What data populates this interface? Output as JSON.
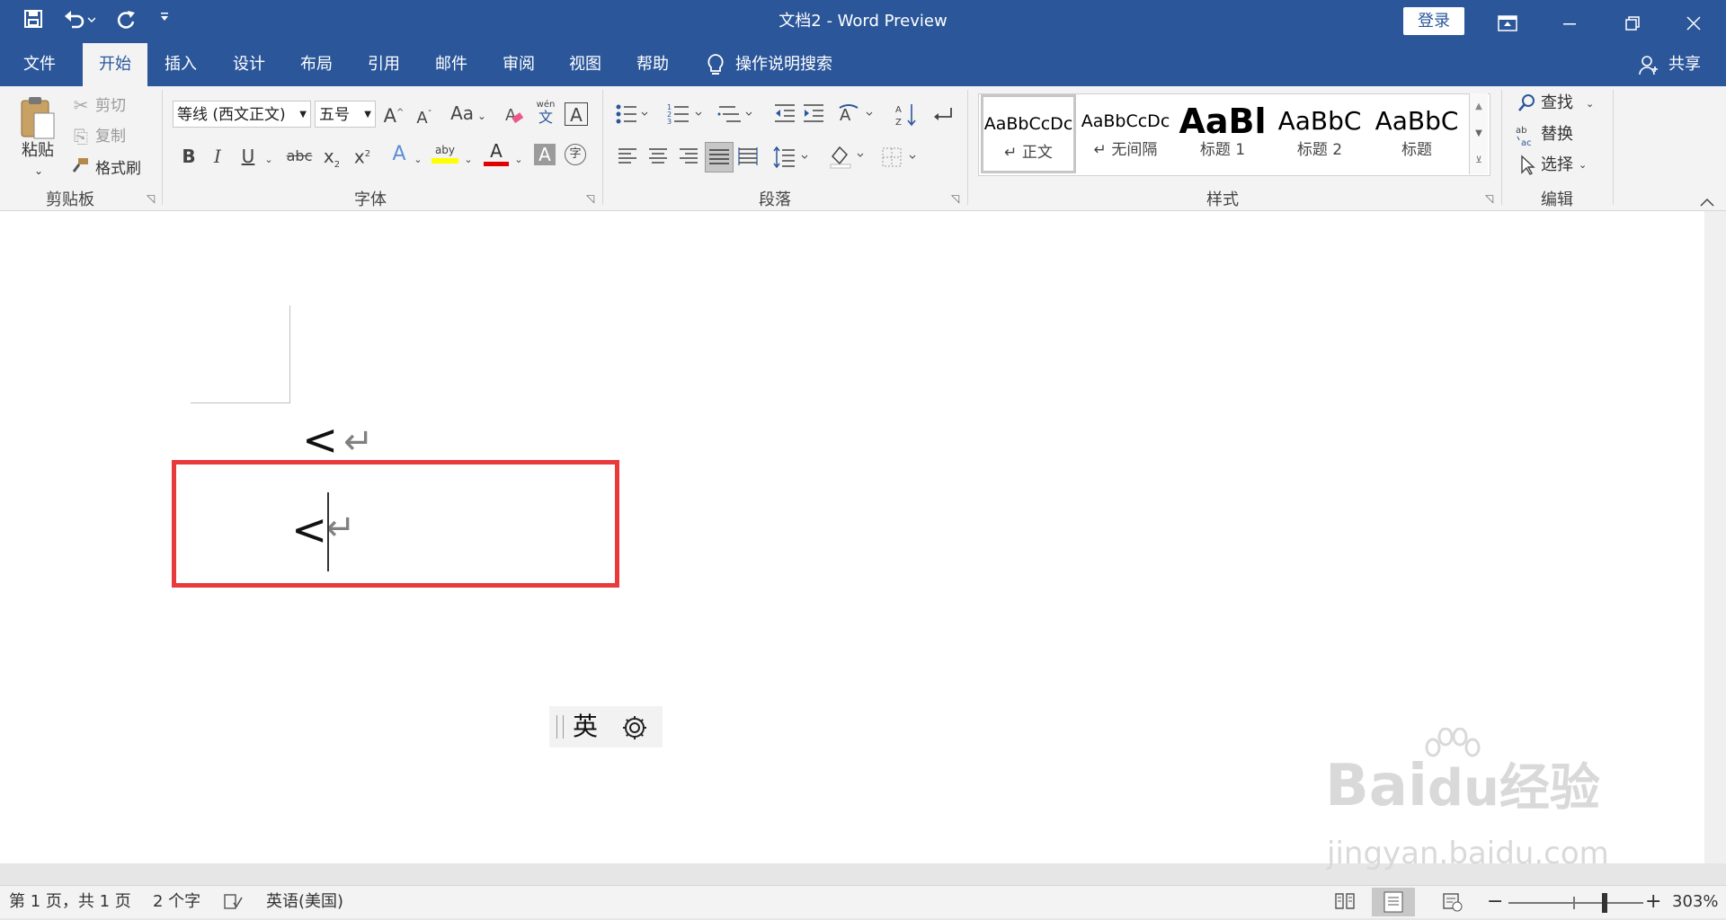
{
  "window": {
    "title": "文档2  -  Word Preview",
    "login_label": "登录",
    "accent_color": "#2b579a",
    "quick_access": [
      "save-icon",
      "undo-icon",
      "redo-icon",
      "customize-icon"
    ],
    "window_controls": [
      "ribbon-display-icon",
      "minimize-icon",
      "restore-icon",
      "close-icon"
    ]
  },
  "tabs": {
    "file": "文件",
    "home": "开始",
    "insert": "插入",
    "design": "设计",
    "layout": "布局",
    "references": "引用",
    "mailings": "邮件",
    "review": "审阅",
    "view": "视图",
    "help": "帮助",
    "tell_me": "操作说明搜索",
    "share": "共享",
    "active": "开始"
  },
  "ribbon": {
    "clipboard": {
      "label": "剪贴板",
      "paste": "粘贴",
      "cut": "剪切",
      "copy": "复制",
      "format_painter": "格式刷"
    },
    "font": {
      "label": "字体",
      "font_name": "等线 (西文正文)",
      "font_size": "五号",
      "grow": "A",
      "shrink": "A",
      "change_case": "Aa",
      "bold": "B",
      "italic": "I",
      "underline": "U",
      "strike": "abc",
      "subscript": "x",
      "superscript": "x",
      "sub_mark": "2",
      "sup_mark": "2",
      "phonetic": "wén",
      "phonetic_char": "文",
      "char_border": "A",
      "text_effects": "A",
      "highlight": "aby",
      "font_color": "A",
      "char_shading": "A",
      "enclose": "字",
      "highlight_color": "#ffff00",
      "font_color_value": "#e00000"
    },
    "paragraph": {
      "label": "段落"
    },
    "styles": {
      "label": "样式",
      "items": [
        {
          "sample": "AaBbCcDc",
          "name": "↵ 正文"
        },
        {
          "sample": "AaBbCcDc",
          "name": "↵ 无间隔"
        },
        {
          "sample": "AaBl",
          "name": "标题 1"
        },
        {
          "sample": "AaBbC",
          "name": "标题 2"
        },
        {
          "sample": "AaBbC",
          "name": "标题"
        }
      ]
    },
    "editing": {
      "label": "编辑",
      "find": "查找",
      "replace": "替换",
      "select": "选择"
    }
  },
  "document": {
    "line1": "<",
    "line2": "<",
    "para_mark": "↵",
    "highlight_color": "#e8393b"
  },
  "ime": {
    "mode": "英",
    "settings_icon": "gear-icon"
  },
  "status": {
    "page": "第 1 页，共 1 页",
    "words": "2 个字",
    "language": "英语(美国)",
    "zoom": "303%",
    "zoom_minus": "−",
    "zoom_plus": "+"
  },
  "watermark": {
    "brand": "Bai",
    "brand2": "du",
    "brand_cn": "经验",
    "url": "jingyan.baidu.com"
  }
}
